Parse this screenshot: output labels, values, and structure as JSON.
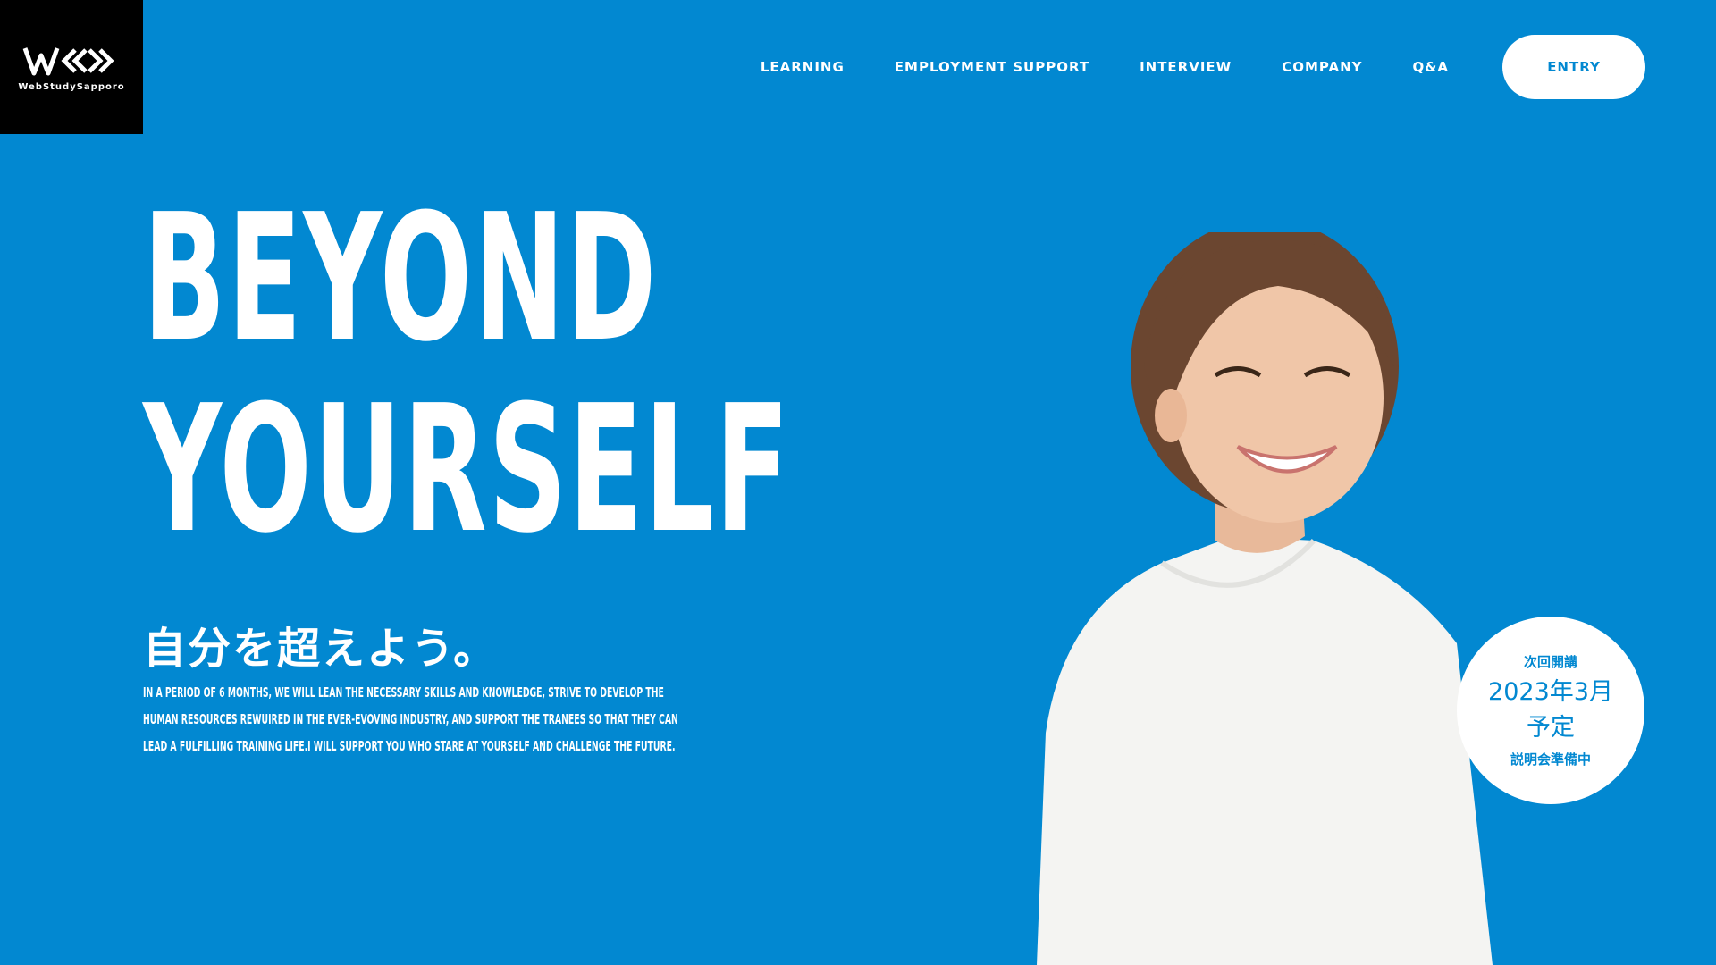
{
  "logo": {
    "subtitle": "WebStudySapporo"
  },
  "nav": {
    "items": [
      {
        "label": "LEARNING"
      },
      {
        "label": "EMPLOYMENT SUPPORT"
      },
      {
        "label": "INTERVIEW"
      },
      {
        "label": "COMPANY"
      },
      {
        "label": "Q&A"
      }
    ],
    "entry_label": "ENTRY"
  },
  "hero": {
    "line1": "BEYOND",
    "line2": "YOURSELF",
    "tagline_jp": "自分を超えよう。",
    "description": "IN A PERIOD OF 6 MONTHS, WE WILL LEAN THE NECESSARY SKILLS AND KNOWLEDGE, STRIVE TO DEVELOP THE HUMAN RESOURCES REWUIRED IN THE EVER-EVOVING INDUSTRY, AND SUPPORT THE TRANEES SO THAT THEY CAN LEAD A FULFILLING TRAINING LIFE.I WILL SUPPORT YOU WHO STARE AT YOURSELF AND CHALLENGE THE FUTURE."
  },
  "badge": {
    "label": "次回開講",
    "date_line1": "2023年3月",
    "date_line2": "予定",
    "sub": "説明会準備中"
  },
  "colors": {
    "background": "#0288d1",
    "logo_bg": "#000000",
    "button_bg": "#ffffff",
    "accent_text": "#0288d1"
  }
}
